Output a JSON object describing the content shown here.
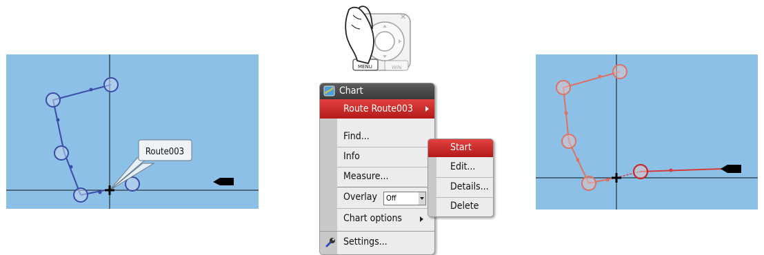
{
  "left_panel": {
    "route_label": "Route003"
  },
  "keypad": {
    "menu_label": "MENU",
    "win_label": "WIN",
    "x_label": "✕"
  },
  "menu": {
    "header": "Chart",
    "route_item": "Route Route003",
    "find": "Find...",
    "info": "Info",
    "measure": "Measure...",
    "overlay_label": "Overlay",
    "overlay_value": "Off",
    "chart_options": "Chart options",
    "settings": "Settings..."
  },
  "submenu": {
    "items": [
      "Start",
      "Edit...",
      "Details...",
      "Delete"
    ]
  },
  "colors": {
    "water": "#8cc0e6",
    "route_blue": "#3a4aa8",
    "route_red": "#d84040",
    "menu_selected": "#c82a28"
  }
}
